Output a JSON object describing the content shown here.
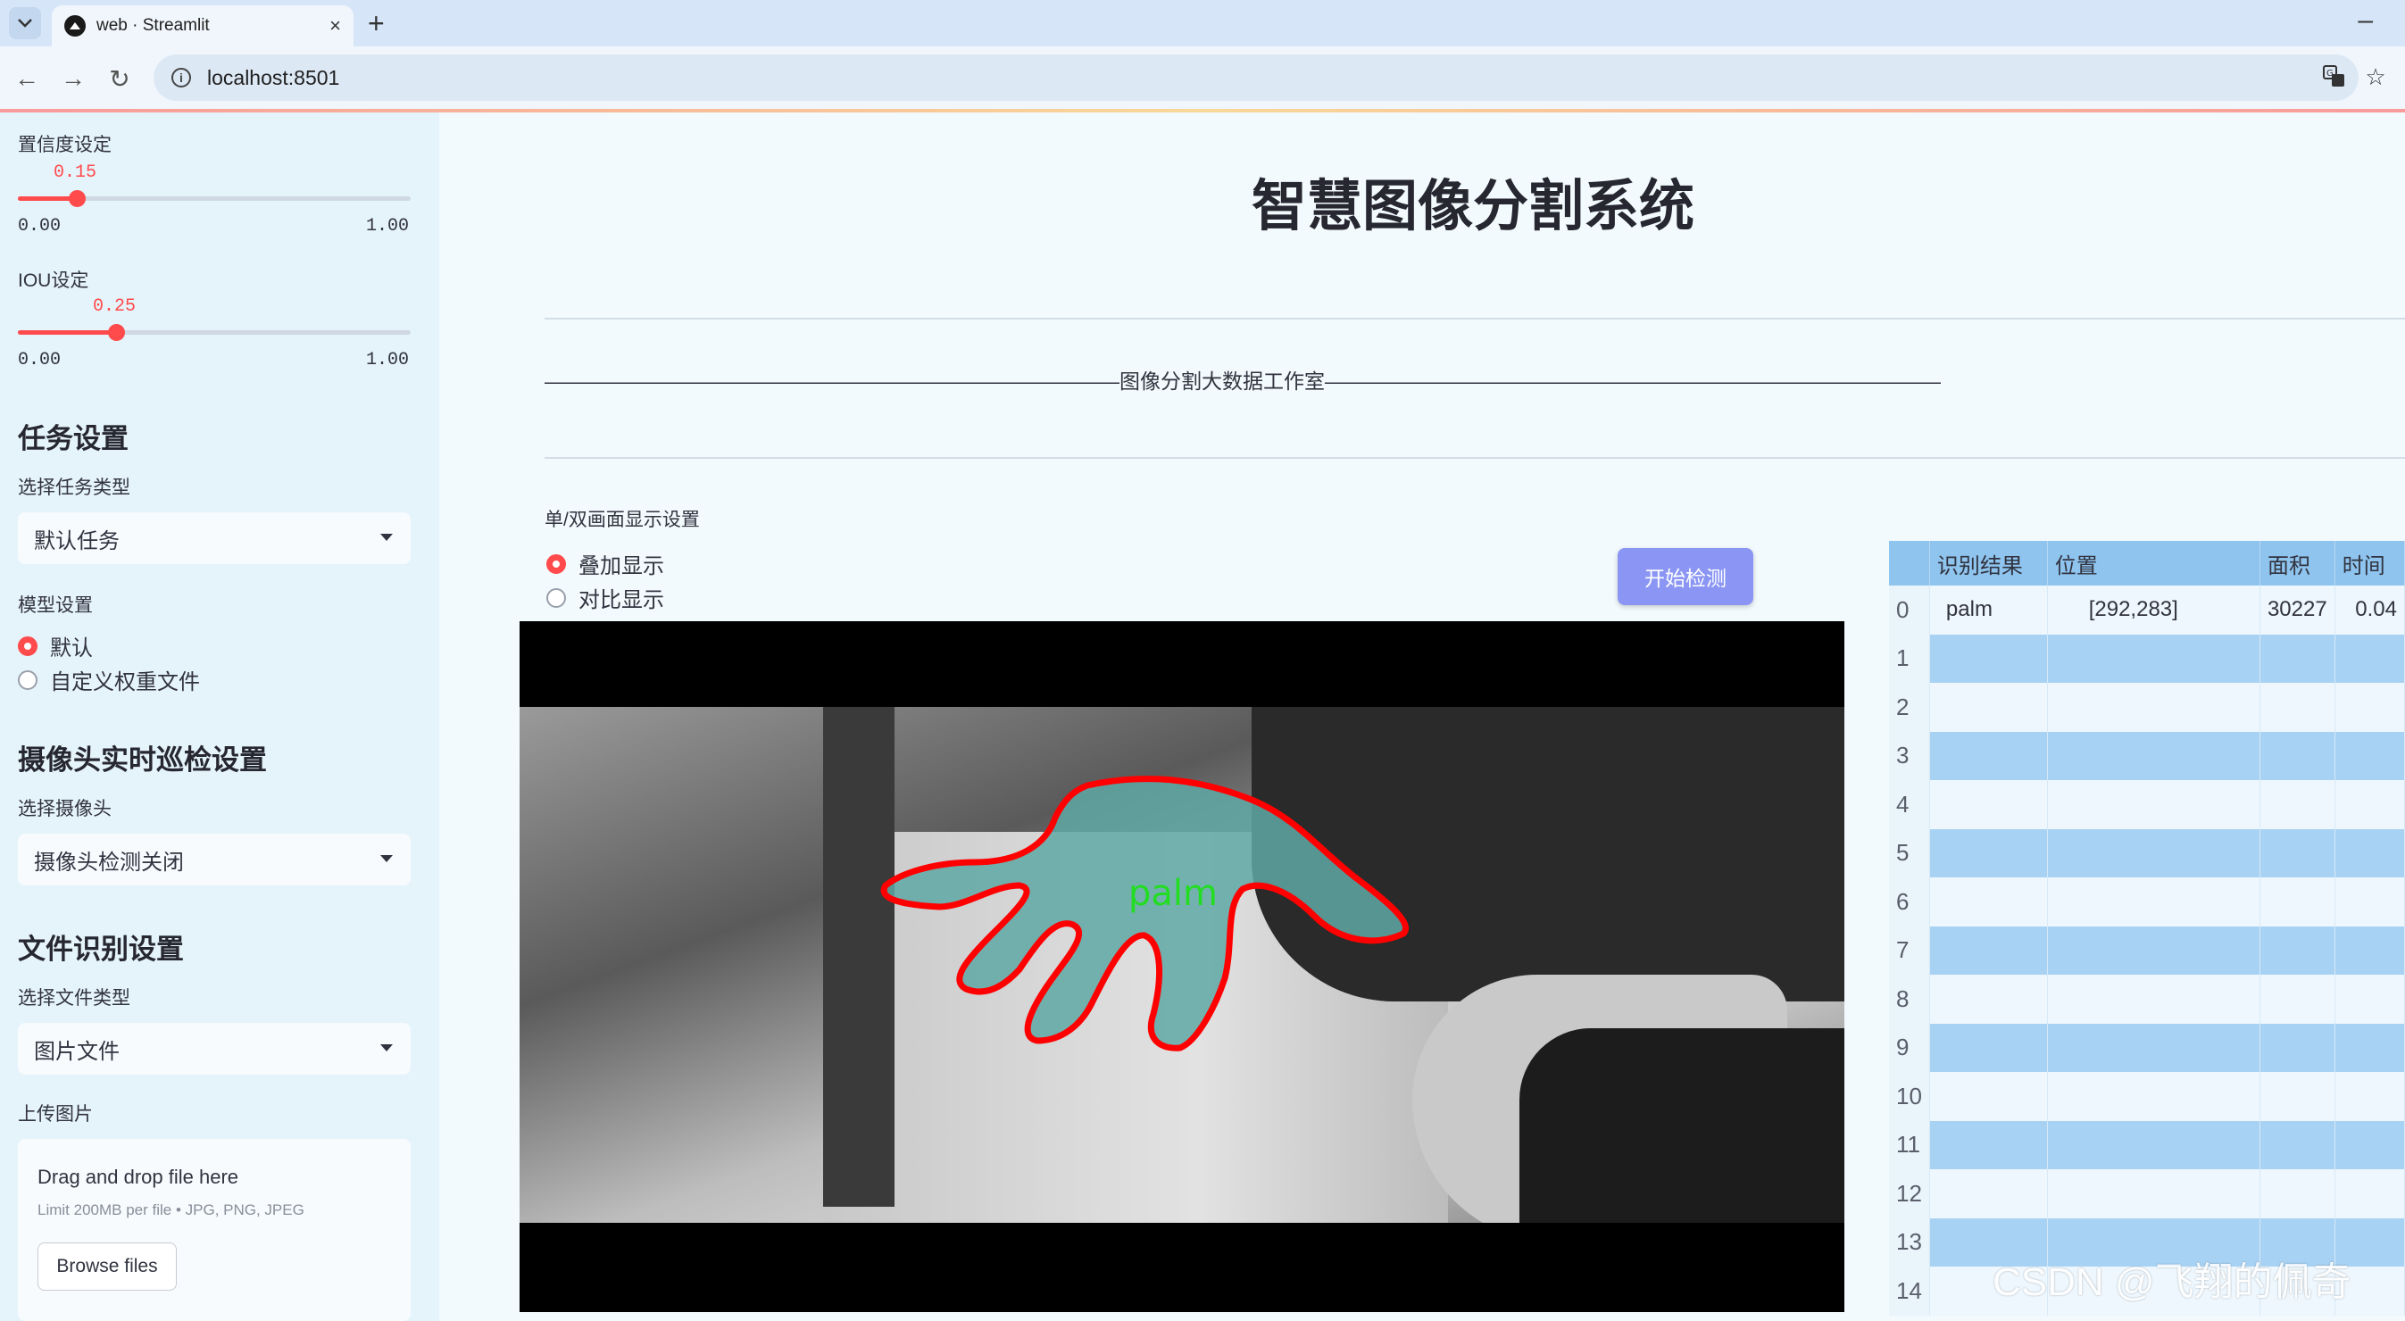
{
  "browser": {
    "tab_title": "web · Streamlit",
    "tab_close": "×",
    "new_tab": "+",
    "minimize": "–",
    "url": "localhost:8501",
    "back": "←",
    "forward": "→",
    "reload": "↻",
    "translate_icon": "translate-icon",
    "star": "☆"
  },
  "sidebar": {
    "confidence": {
      "label": "置信度设定",
      "value": "0.15",
      "min": "0.00",
      "max": "1.00",
      "fraction": 0.15
    },
    "iou": {
      "label": "IOU设定",
      "value": "0.25",
      "min": "0.00",
      "max": "1.00",
      "fraction": 0.25
    },
    "task_header": "任务设置",
    "task_type_label": "选择任务类型",
    "task_type_value": "默认任务",
    "model_label": "模型设置",
    "model_options": [
      "默认",
      "自定义权重文件"
    ],
    "model_selected": 0,
    "camera_header": "摄像头实时巡检设置",
    "camera_label": "选择摄像头",
    "camera_value": "摄像头检测关闭",
    "file_header": "文件识别设置",
    "file_type_label": "选择文件类型",
    "file_type_value": "图片文件",
    "upload_label": "上传图片",
    "upload_title": "Drag and drop file here",
    "upload_limit": "Limit 200MB per file • JPG, PNG, JPEG",
    "browse_label": "Browse files"
  },
  "main": {
    "title": "智慧图像分割系统",
    "subtitle_line": "————————————————————————————图像分割大数据工作室——————————————————————————————",
    "display_label": "单/双画面显示设置",
    "display_options": [
      "叠加显示",
      "对比显示"
    ],
    "display_selected": 0,
    "start_button": "开始检测",
    "detection_label": "palm"
  },
  "table": {
    "columns": [
      "",
      "识别结果",
      "位置",
      "面积",
      "时间"
    ],
    "rows": [
      [
        "0",
        "palm",
        "[292,283]",
        "30227",
        "0.04"
      ],
      [
        "1",
        "",
        "",
        "",
        ""
      ],
      [
        "2",
        "",
        "",
        "",
        ""
      ],
      [
        "3",
        "",
        "",
        "",
        ""
      ],
      [
        "4",
        "",
        "",
        "",
        ""
      ],
      [
        "5",
        "",
        "",
        "",
        ""
      ],
      [
        "6",
        "",
        "",
        "",
        ""
      ],
      [
        "7",
        "",
        "",
        "",
        ""
      ],
      [
        "8",
        "",
        "",
        "",
        ""
      ],
      [
        "9",
        "",
        "",
        "",
        ""
      ],
      [
        "10",
        "",
        "",
        "",
        ""
      ],
      [
        "11",
        "",
        "",
        "",
        ""
      ],
      [
        "12",
        "",
        "",
        "",
        ""
      ],
      [
        "13",
        "",
        "",
        "",
        ""
      ],
      [
        "14",
        "",
        "",
        "",
        ""
      ]
    ]
  },
  "watermark": "CSDN @飞翔的佩奇",
  "colors": {
    "accent": "#ff4b4b",
    "button": "#8b96f4",
    "table_header": "#8ec4ee",
    "mask_fill": "#5fa8a4",
    "mask_outline": "#ff0000",
    "label_green": "#22dd22"
  }
}
